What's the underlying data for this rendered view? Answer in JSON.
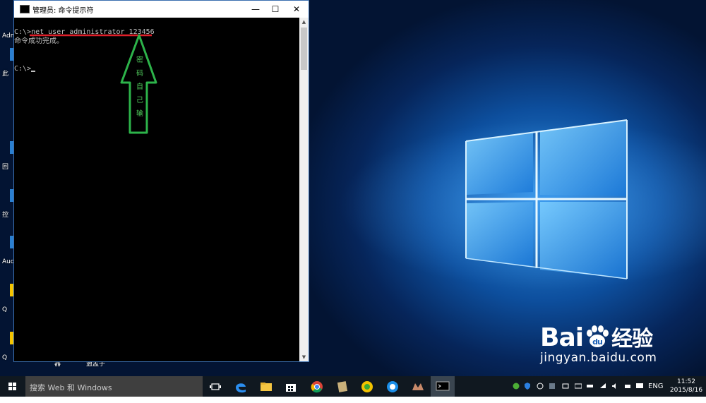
{
  "desktop": {
    "icon_labels": [
      "Adm",
      "此",
      "回",
      "控",
      "Aud",
      "Q",
      "Q"
    ],
    "below_window_labels": [
      "器",
      "盟孟子"
    ]
  },
  "cmd_window": {
    "title": "管理员: 命令提示符",
    "minimize": "—",
    "maximize": "☐",
    "close": "✕",
    "console_lines": [
      "C:\\>net user administrator 123456",
      "命令成功完成。",
      "",
      "C:\\>"
    ]
  },
  "annotation": {
    "chars": [
      "密",
      "码",
      "自",
      "己",
      "输"
    ],
    "underline_color": "#e0202a",
    "arrow_color": "#2db34a"
  },
  "watermark": {
    "brand_latin_1": "Bai",
    "brand_latin_2": "du",
    "brand_cn": "经验",
    "url": "jingyan.baidu.com"
  },
  "taskbar": {
    "search_placeholder": "搜索 Web 和 Windows",
    "icons": [
      "task-view-icon",
      "edge-icon",
      "file-explorer-icon",
      "store-icon",
      "chrome-icon",
      "app-icon",
      "app2-icon",
      "qq-icon",
      "game-icon",
      "cmd-icon"
    ],
    "language": "ENG",
    "time": "11:52",
    "date": "2015/8/16"
  },
  "colors": {
    "taskbar": "#101820",
    "console_text": "#c0c0c0",
    "accent_blue": "#2f8fe0"
  }
}
